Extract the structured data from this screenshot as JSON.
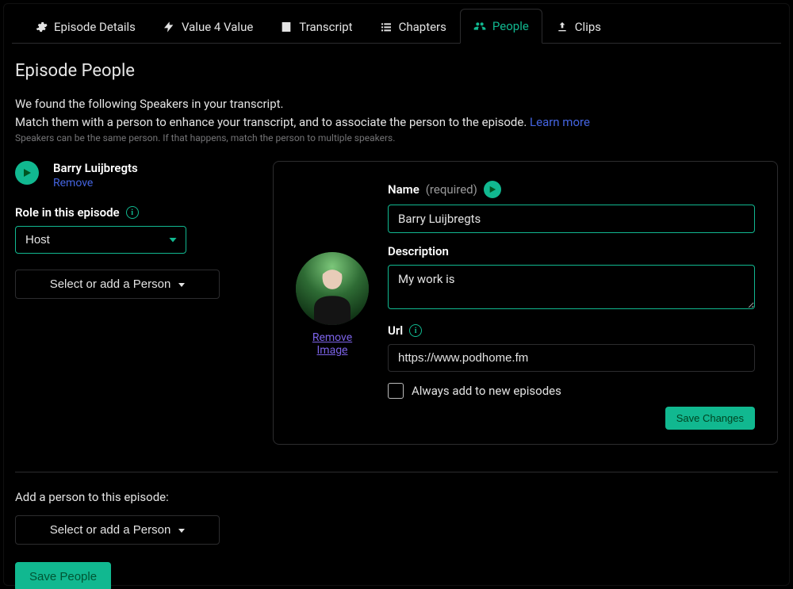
{
  "tabs": [
    {
      "label": "Episode Details",
      "active": false
    },
    {
      "label": "Value 4 Value",
      "active": false
    },
    {
      "label": "Transcript",
      "active": false
    },
    {
      "label": "Chapters",
      "active": false
    },
    {
      "label": "People",
      "active": true
    },
    {
      "label": "Clips",
      "active": false
    }
  ],
  "page_title": "Episode People",
  "intro_line1": "We found the following Speakers in your transcript.",
  "intro_line2_prefix": "Match them with a person to enhance your transcript, and to associate the person to the episode. ",
  "learn_more": "Learn more",
  "intro_note": "Speakers can be the same person. If that happens, match the person to multiple speakers.",
  "speaker": {
    "name": "Barry Luijbregts",
    "remove_label": "Remove",
    "role_label": "Role in this episode",
    "role_value": "Host",
    "select_person_label": "Select or add a Person"
  },
  "card": {
    "remove_image_label": "Remove Image",
    "name_label": "Name",
    "name_required": "(required)",
    "name_value": "Barry Luijbregts",
    "description_label": "Description",
    "description_value": "My work is",
    "url_label": "Url",
    "url_value": "https://www.podhome.fm",
    "always_add_label": "Always add to new episodes",
    "always_add_checked": false,
    "save_changes_label": "Save Changes"
  },
  "add_section": {
    "label": "Add a person to this episode:",
    "select_label": "Select or add a Person"
  },
  "save_people_label": "Save People"
}
